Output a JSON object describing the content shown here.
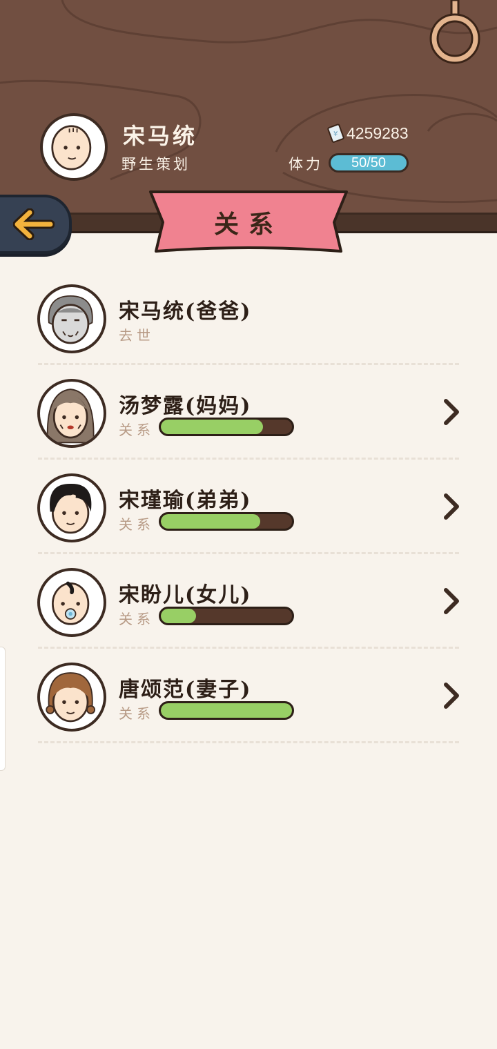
{
  "player": {
    "name": "宋马统",
    "title": "野生策划",
    "money": "4259283",
    "stamina_label": "体力",
    "stamina": "50/50"
  },
  "page": {
    "title": "关系"
  },
  "relations": [
    {
      "name": "宋马统(爸爸)",
      "status": "去世",
      "avatar": "old-man-avatar",
      "has_bar": false
    },
    {
      "name": "汤梦露(妈妈)",
      "status": "关系",
      "avatar": "mother-avatar",
      "has_bar": true,
      "level": 0.78
    },
    {
      "name": "宋瑾瑜(弟弟)",
      "status": "关系",
      "avatar": "brother-avatar",
      "has_bar": true,
      "level": 0.76
    },
    {
      "name": "宋盼儿(女儿)",
      "status": "关系",
      "avatar": "baby-avatar",
      "has_bar": true,
      "level": 0.27
    },
    {
      "name": "唐颂范(妻子)",
      "status": "关系",
      "avatar": "wife-avatar",
      "has_bar": true,
      "level": 1.0
    }
  ],
  "colors": {
    "header_wood": "#714f41",
    "banner_pink": "#f08290",
    "bar_green": "#98cf65",
    "stamina_blue": "#5cbcd4"
  }
}
